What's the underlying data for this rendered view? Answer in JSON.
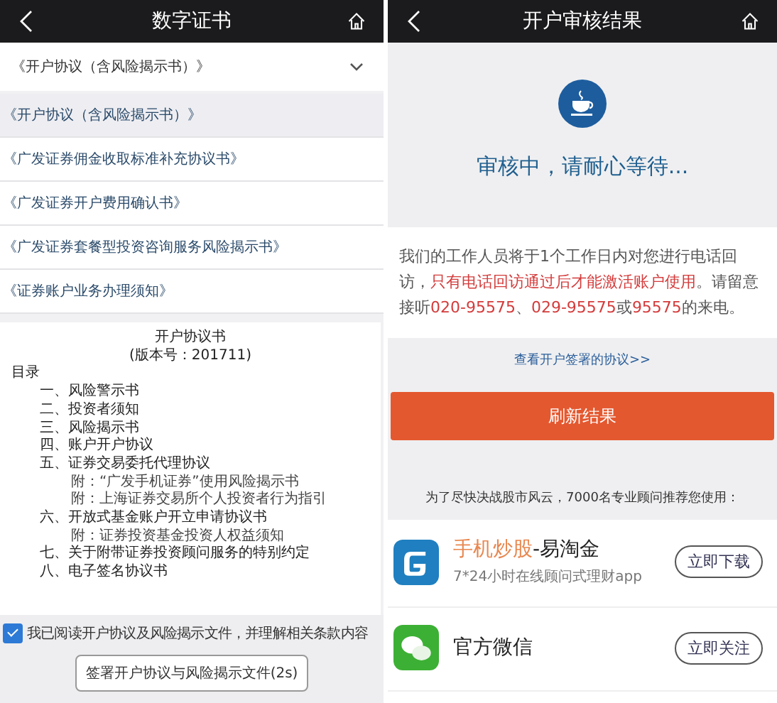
{
  "left_screen": {
    "title": "数字证书",
    "dropdown": {
      "label": "《开户协议（含风险揭示书）》"
    },
    "documents": [
      {
        "label": "《开户协议（含风险揭示书）》",
        "selected": true
      },
      {
        "label": "《广发证券佣金收取标准补充协议书》",
        "selected": false
      },
      {
        "label": "《广发证券开户费用确认书》",
        "selected": false
      },
      {
        "label": "《广发证券套餐型投资咨询服务风险揭示书》",
        "selected": false
      },
      {
        "label": "《证券账户业务办理须知》",
        "selected": false
      }
    ],
    "agreement": {
      "title": "开户协议书",
      "version": "(版本号：201711)",
      "toc_heading": "目录",
      "toc": [
        {
          "text": "一、风险警示书"
        },
        {
          "text": "二、投资者须知"
        },
        {
          "text": "三、风险揭示书"
        },
        {
          "text": "四、账户开户协议"
        },
        {
          "text": "五、证券交易委托代理协议",
          "children": [
            {
              "text": "附：“广发手机证券”使用风险揭示书"
            },
            {
              "text": "附：上海证券交易所个人投资者行为指引"
            }
          ]
        },
        {
          "text": "六、开放式基金账户开立申请协议书",
          "children": [
            {
              "text": "附：证券投资基金投资人权益须知"
            }
          ]
        },
        {
          "text": "七、关于附带证券投资顾问服务的特别约定"
        },
        {
          "text": "八、电子签名协议书"
        }
      ]
    },
    "consent": {
      "label": "我已阅读开户协议及风险揭示文件，并理解相关条款内容",
      "checked": true
    },
    "sign_button": "签署开户协议与风险揭示文件(2s)"
  },
  "right_screen": {
    "title": "开户审核结果",
    "status": "审核中，请耐心等待...",
    "notice": [
      {
        "text": "我们的工作人员将于1个工作日内对您进行电话回访，",
        "highlight": false
      },
      {
        "text": "只有电话回访通过后才能激活账户使用",
        "highlight": true
      },
      {
        "text": "。请留意接听",
        "highlight": false
      },
      {
        "text": "020-95575",
        "highlight": true
      },
      {
        "text": "、",
        "highlight": false
      },
      {
        "text": "029-95575",
        "highlight": true
      },
      {
        "text": "或",
        "highlight": false
      },
      {
        "text": "95575",
        "highlight": true
      },
      {
        "text": "的来电。",
        "highlight": false
      }
    ],
    "agreement_link": "查看开户签署的协议>>",
    "refresh_button": "刷新结果",
    "recommend_text": "为了尽快决战股市风云，7000名专业顾问推荐您使用：",
    "apps": [
      {
        "kind": "trading",
        "name": [
          {
            "text": "手机炒股",
            "highlight": true
          },
          {
            "text": "-易淘金",
            "highlight": false
          }
        ],
        "subtitle": "7*24小时在线顾问式理财app",
        "button": "立即下载"
      },
      {
        "kind": "wechat",
        "name": [
          {
            "text": "官方微信",
            "highlight": false
          }
        ],
        "button": "立即关注"
      }
    ]
  }
}
